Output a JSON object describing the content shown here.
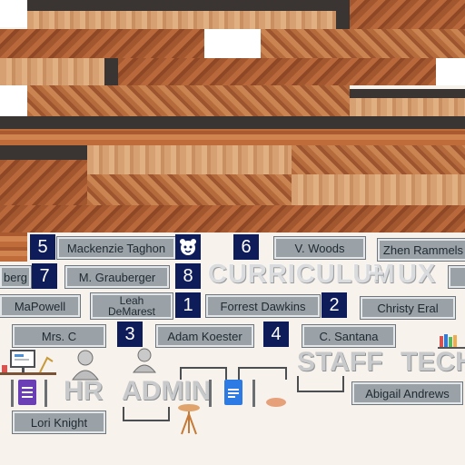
{
  "staff_tags": {
    "taghon": "Mackenzie Taghon",
    "woods": "V. Woods",
    "rammels": "Zhen Rammels",
    "berg": "berg",
    "grauberger": "M. Grauberger",
    "mapowell": "MaPowell",
    "demarest": "Leah\nDeMarest",
    "dawkins": "Forrest Dawkins",
    "eral": "Christy Eral",
    "mrs_c": "Mrs. C",
    "koester": "Adam Koester",
    "santana": "C. Santana",
    "andrews": "Abigail Andrews",
    "knight": "Lori Knight"
  },
  "numbers": {
    "n1": "1",
    "n2": "2",
    "n3": "3",
    "n4": "4",
    "n5": "5",
    "n6": "6",
    "n7": "7",
    "n8": "8"
  },
  "section_words": {
    "curriculum": "CURRICULUM",
    "plus": "+",
    "ux": "UX",
    "hr": "HR",
    "admin": "ADMIN",
    "staff": "STAFF",
    "tech": "TECH"
  },
  "colors": {
    "tag_bg": "#9aa2a8",
    "number_bg": "#0f1c5a",
    "shelf": "#3a3532"
  },
  "icons": [
    "bear-mascot-icon",
    "forms-icon",
    "docs-icon",
    "bust-statue-icon",
    "computer-desk-icon",
    "lamp-icon",
    "books-icon"
  ]
}
